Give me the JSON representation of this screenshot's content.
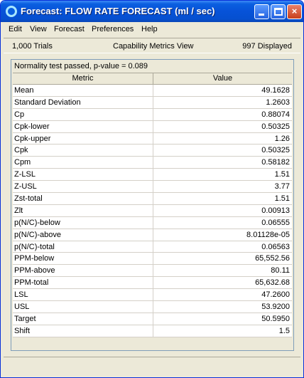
{
  "window": {
    "title": "Forecast: FLOW RATE FORECAST (ml / sec)",
    "app_icon": "crystal-ball-icon",
    "controls": {
      "minimize": "minimize-icon",
      "maximize": "maximize-icon",
      "close": "×"
    }
  },
  "menu": {
    "items": [
      "Edit",
      "View",
      "Forecast",
      "Preferences",
      "Help"
    ]
  },
  "info": {
    "trials": "1,000 Trials",
    "view_name": "Capability Metrics View",
    "displayed": "997 Displayed"
  },
  "panel": {
    "normality": "Normality test passed, p-value = 0.089",
    "headers": {
      "metric": "Metric",
      "value": "Value"
    },
    "rows": [
      {
        "metric": "Mean",
        "value": "49.1628"
      },
      {
        "metric": "Standard Deviation",
        "value": "1.2603"
      },
      {
        "metric": "Cp",
        "value": "0.88074"
      },
      {
        "metric": "Cpk-lower",
        "value": "0.50325"
      },
      {
        "metric": "Cpk-upper",
        "value": "1.26"
      },
      {
        "metric": "Cpk",
        "value": "0.50325"
      },
      {
        "metric": "Cpm",
        "value": "0.58182"
      },
      {
        "metric": "Z-LSL",
        "value": "1.51"
      },
      {
        "metric": "Z-USL",
        "value": "3.77"
      },
      {
        "metric": "Zst-total",
        "value": "1.51"
      },
      {
        "metric": "Zlt",
        "value": "0.00913"
      },
      {
        "metric": "p(N/C)-below",
        "value": "0.06555"
      },
      {
        "metric": "p(N/C)-above",
        "value": "8.01128e-05"
      },
      {
        "metric": "p(N/C)-total",
        "value": "0.06563"
      },
      {
        "metric": "PPM-below",
        "value": "65,552.56"
      },
      {
        "metric": "PPM-above",
        "value": "80.11"
      },
      {
        "metric": "PPM-total",
        "value": "65,632.68"
      },
      {
        "metric": "LSL",
        "value": "47.2600"
      },
      {
        "metric": "USL",
        "value": "53.9200"
      },
      {
        "metric": "Target",
        "value": "50.5950"
      },
      {
        "metric": "Shift",
        "value": "1.5"
      }
    ]
  }
}
